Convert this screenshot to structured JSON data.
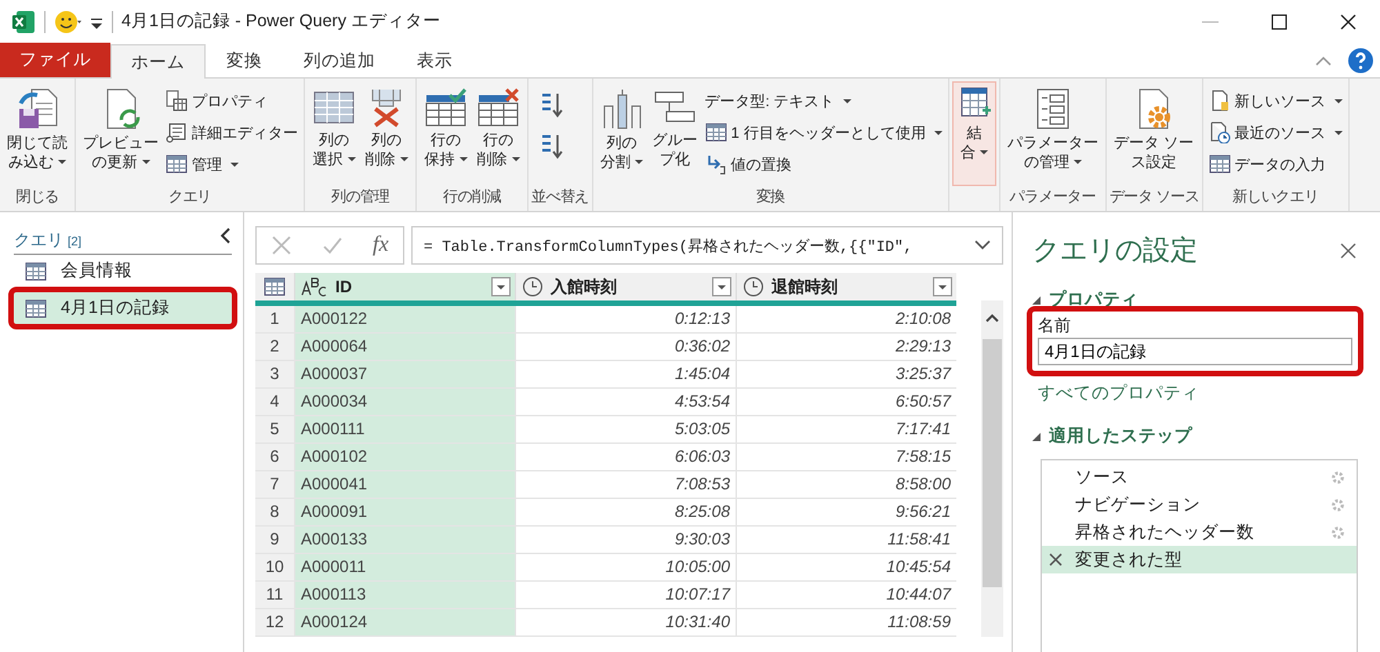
{
  "window": {
    "title": "4月1日の記録 - Power Query エディター"
  },
  "tabs": [
    {
      "label": "ファイル",
      "kind": "file",
      "selected": false
    },
    {
      "label": "ホーム",
      "kind": "normal",
      "selected": true
    },
    {
      "label": "変換",
      "kind": "normal",
      "selected": false
    },
    {
      "label": "列の追加",
      "kind": "normal",
      "selected": false
    },
    {
      "label": "表示",
      "kind": "normal",
      "selected": false
    }
  ],
  "ribbon": [
    {
      "label": "閉じる",
      "items": [
        {
          "kind": "large",
          "lines": [
            "閉じて読",
            "み込む"
          ],
          "dropdown": true,
          "highlighted": false
        }
      ]
    },
    {
      "label": "クエリ",
      "items": [
        {
          "kind": "large",
          "lines": [
            "プレビュー",
            "の更新"
          ],
          "dropdown": true,
          "highlighted": false
        },
        {
          "kind": "small",
          "label": "プロパティ",
          "dropdown": false
        },
        {
          "kind": "small",
          "label": "詳細エディター",
          "dropdown": false
        },
        {
          "kind": "small",
          "label": "管理",
          "dropdown": true
        }
      ]
    },
    {
      "label": "列の管理",
      "items": [
        {
          "kind": "large",
          "lines": [
            "列の",
            "選択"
          ],
          "dropdown": true,
          "highlighted": false
        },
        {
          "kind": "large",
          "lines": [
            "列の",
            "削除"
          ],
          "dropdown": true,
          "highlighted": false
        }
      ]
    },
    {
      "label": "行の削減",
      "items": [
        {
          "kind": "large",
          "lines": [
            "行の",
            "保持"
          ],
          "dropdown": true,
          "highlighted": false
        },
        {
          "kind": "large",
          "lines": [
            "行の",
            "削除"
          ],
          "dropdown": true,
          "highlighted": false
        }
      ]
    },
    {
      "label": "並べ替え",
      "items": [
        {
          "kind": "icon"
        },
        {
          "kind": "icon"
        }
      ]
    },
    {
      "label": "変換",
      "items": [
        {
          "kind": "large",
          "lines": [
            "列の",
            "分割"
          ],
          "dropdown": true,
          "highlighted": false
        },
        {
          "kind": "large",
          "lines": [
            "グルー",
            "プ化"
          ],
          "dropdown": false,
          "highlighted": false
        },
        {
          "kind": "small",
          "label": "データ型: テキスト",
          "dropdown": true
        },
        {
          "kind": "small",
          "label": "1 行目をヘッダーとして使用",
          "dropdown": true
        },
        {
          "kind": "small",
          "label": "値の置換",
          "dropdown": false
        }
      ]
    },
    {
      "items": [
        {
          "kind": "large",
          "lines": [
            "結",
            "合"
          ],
          "dropdown": true,
          "highlighted": true
        }
      ]
    },
    {
      "label": "パラメーター",
      "items": [
        {
          "kind": "large",
          "lines": [
            "パラメーター",
            "の管理"
          ],
          "dropdown": true,
          "highlighted": false
        }
      ]
    },
    {
      "label": "データ ソース",
      "items": [
        {
          "kind": "large",
          "lines": [
            "データ ソー",
            "ス設定"
          ],
          "dropdown": false,
          "highlighted": false
        }
      ]
    },
    {
      "label": "新しいクエリ",
      "items": [
        {
          "kind": "small",
          "label": "新しいソース",
          "dropdown": true
        },
        {
          "kind": "small",
          "label": "最近のソース",
          "dropdown": true
        },
        {
          "kind": "small",
          "label": "データの入力",
          "dropdown": false
        }
      ]
    }
  ],
  "queries": {
    "title": "クエリ",
    "count": "[2]",
    "items": [
      {
        "label": "会員情報",
        "selected": false,
        "boxed": false
      },
      {
        "label": "4月1日の記録",
        "selected": true,
        "boxed": true
      }
    ]
  },
  "formula_bar": {
    "fx": "fx",
    "formula": "= Table.TransformColumnTypes(昇格されたヘッダー数,{{\"ID\","
  },
  "table": {
    "columns": [
      {
        "name": "ID",
        "kind": "text",
        "selected": true
      },
      {
        "name": "入館時刻",
        "kind": "time",
        "selected": false
      },
      {
        "name": "退館時刻",
        "kind": "time",
        "selected": false
      }
    ],
    "rows": [
      {
        "n": "1",
        "cells": [
          "A000122",
          "0:12:13",
          "2:10:08"
        ]
      },
      {
        "n": "2",
        "cells": [
          "A000064",
          "0:36:02",
          "2:29:13"
        ]
      },
      {
        "n": "3",
        "cells": [
          "A000037",
          "1:45:04",
          "3:25:37"
        ]
      },
      {
        "n": "4",
        "cells": [
          "A000034",
          "4:53:54",
          "6:50:57"
        ]
      },
      {
        "n": "5",
        "cells": [
          "A000111",
          "5:03:05",
          "7:17:41"
        ]
      },
      {
        "n": "6",
        "cells": [
          "A000102",
          "6:06:03",
          "7:58:15"
        ]
      },
      {
        "n": "7",
        "cells": [
          "A000041",
          "7:08:53",
          "8:58:00"
        ]
      },
      {
        "n": "8",
        "cells": [
          "A000091",
          "8:25:08",
          "9:56:21"
        ]
      },
      {
        "n": "9",
        "cells": [
          "A000133",
          "9:30:03",
          "11:58:41"
        ]
      },
      {
        "n": "10",
        "cells": [
          "A000011",
          "10:05:00",
          "10:45:54"
        ]
      },
      {
        "n": "11",
        "cells": [
          "A000113",
          "10:07:17",
          "10:44:07"
        ]
      },
      {
        "n": "12",
        "cells": [
          "A000124",
          "10:31:40",
          "11:08:59"
        ]
      }
    ]
  },
  "settings": {
    "title": "クエリの設定",
    "properties": {
      "heading": "プロパティ",
      "name_label": "名前",
      "name_value": "4月1日の記録",
      "boxed": true,
      "all_link": "すべてのプロパティ"
    },
    "steps_heading": "適用したステップ",
    "steps": [
      {
        "label": "ソース",
        "settings": true,
        "selected": false
      },
      {
        "label": "ナビゲーション",
        "settings": true,
        "selected": false
      },
      {
        "label": "昇格されたヘッダー数",
        "settings": true,
        "selected": false
      },
      {
        "label": "変更された型",
        "settings": false,
        "selected": true
      }
    ]
  }
}
